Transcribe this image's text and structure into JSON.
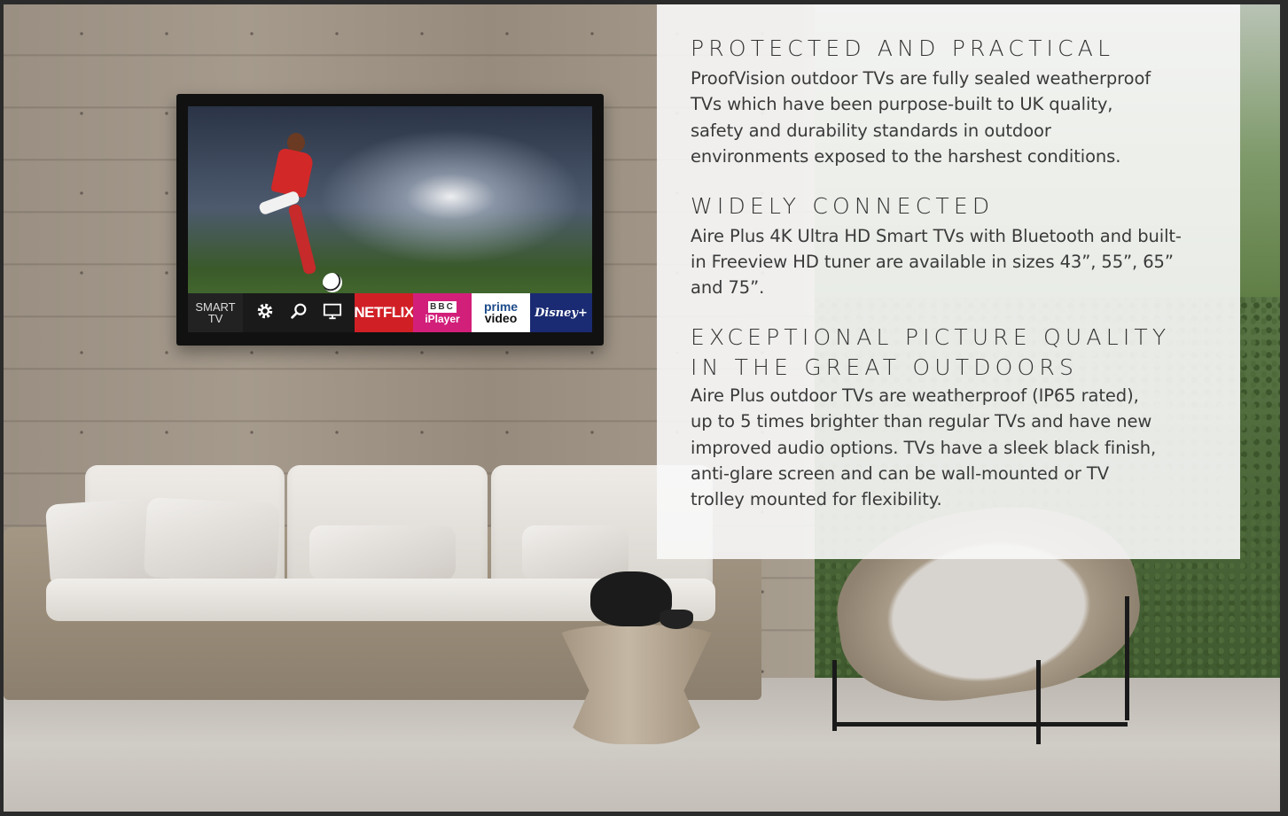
{
  "tv": {
    "menu": {
      "smart_label": "SMART\nTV",
      "icons": [
        "gear-icon",
        "search-icon",
        "monitor-icon"
      ],
      "apps": {
        "netflix": "NETFLIX",
        "bbc_top": "BBC",
        "bbc_bottom": "iPlayer",
        "prime_top": "prime",
        "prime_bottom": "video",
        "disney": "Disney+"
      }
    }
  },
  "panel": {
    "sections": [
      {
        "heading": "PROTECTED AND PRACTICAL",
        "body": "ProofVision outdoor TVs are fully sealed weatherproof\nTVs which have been purpose-built to UK quality,\nsafety and durability standards in outdoor\nenvironments exposed to the harshest conditions."
      },
      {
        "heading": "WIDELY CONNECTED",
        "body": "Aire Plus 4K Ultra HD Smart TVs with Bluetooth and built-\nin Freeview HD tuner are available in sizes 43”, 55”, 65”\nand 75”."
      },
      {
        "heading": "EXCEPTIONAL PICTURE QUALITY\nIN THE GREAT OUTDOORS",
        "body": "Aire Plus outdoor TVs are weatherproof (IP65 rated),\nup to 5 times brighter than regular TVs and have new\nimproved audio options. TVs have a sleek black finish,\nanti-glare screen and can be wall-mounted or TV\ntrolley mounted for flexibility."
      }
    ]
  },
  "colors": {
    "panel_bg": "#f8f8f8",
    "text": "#333333",
    "netflix_red": "#d11f26",
    "bbc_pink": "#d21f7a",
    "disney_blue": "#1a2b73"
  }
}
